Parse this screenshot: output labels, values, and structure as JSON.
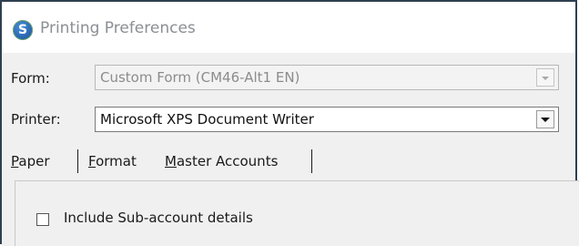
{
  "window": {
    "title": "Printing Preferences",
    "icon_letter": "S"
  },
  "form_row": {
    "label": "Form:",
    "value": "Custom Form (CM46-Alt1 EN)",
    "enabled": false
  },
  "printer_row": {
    "label": "Printer:",
    "value": "Microsoft XPS Document Writer",
    "enabled": true
  },
  "tabs": [
    {
      "label": "Paper",
      "mnemonic": "P",
      "rest": "aper"
    },
    {
      "label": "Format",
      "mnemonic": "F",
      "rest": "ormat"
    },
    {
      "label": "Master Accounts",
      "mnemonic": "M",
      "rest": "aster Accounts"
    }
  ],
  "options": {
    "include_subaccount": {
      "label": "Include Sub-account details",
      "checked": false
    }
  }
}
